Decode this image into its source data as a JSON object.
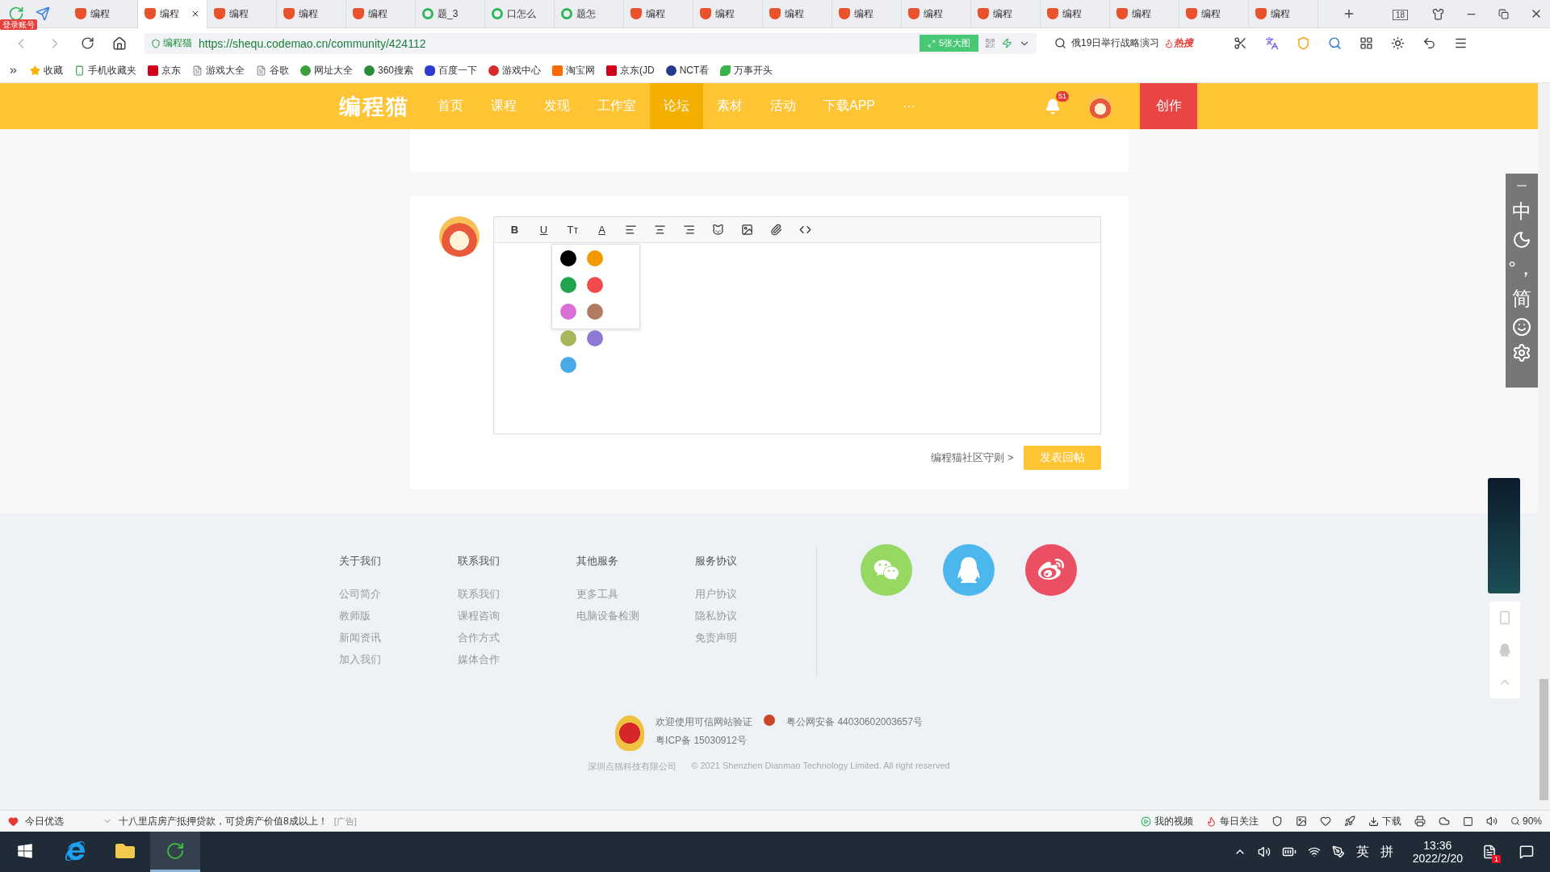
{
  "browser": {
    "login_badge": "登录账号",
    "tabs": [
      {
        "label": "编程",
        "kind": "site",
        "selected": false
      },
      {
        "label": "编程",
        "kind": "site",
        "selected": true
      },
      {
        "label": "编程",
        "kind": "site",
        "selected": false
      },
      {
        "label": "编程",
        "kind": "site",
        "selected": false
      },
      {
        "label": "编程",
        "kind": "site",
        "selected": false
      },
      {
        "label": "题_3",
        "kind": "search",
        "selected": false
      },
      {
        "label": "口怎么",
        "kind": "search",
        "selected": false
      },
      {
        "label": "题怎",
        "kind": "search",
        "selected": false
      },
      {
        "label": "编程",
        "kind": "site",
        "selected": false
      },
      {
        "label": "编程",
        "kind": "site",
        "selected": false
      },
      {
        "label": "编程",
        "kind": "site",
        "selected": false
      },
      {
        "label": "编程",
        "kind": "site",
        "selected": false
      },
      {
        "label": "编程",
        "kind": "site",
        "selected": false
      },
      {
        "label": "编程",
        "kind": "site",
        "selected": false
      },
      {
        "label": "编程",
        "kind": "site",
        "selected": false
      },
      {
        "label": "编程",
        "kind": "site",
        "selected": false
      },
      {
        "label": "编程",
        "kind": "site",
        "selected": false
      },
      {
        "label": "编程",
        "kind": "site",
        "selected": false
      }
    ],
    "tab_count": "18",
    "address": {
      "site_label": "编程猫",
      "url": "https://shequ.codemao.cn/community/424112",
      "image_button": "5张大图"
    },
    "search": {
      "value": "俄19日举行战略演习",
      "hot_label": "热搜"
    },
    "bookmarks": [
      {
        "label": "收藏",
        "kind": "star"
      },
      {
        "label": "手机收藏夹",
        "kind": "phone"
      },
      {
        "label": "京东",
        "kind": "jd"
      },
      {
        "label": "游戏大全",
        "kind": "page"
      },
      {
        "label": "谷歌",
        "kind": "page"
      },
      {
        "label": "网址大全",
        "kind": "compass"
      },
      {
        "label": "360搜索",
        "kind": "ring"
      },
      {
        "label": "百度一下",
        "kind": "paw"
      },
      {
        "label": "游戏中心",
        "kind": "game"
      },
      {
        "label": "淘宝网",
        "kind": "taobao"
      },
      {
        "label": "京东(JD",
        "kind": "jd"
      },
      {
        "label": "NCT看",
        "kind": "nct"
      },
      {
        "label": "万事开头",
        "kind": "leaf"
      }
    ]
  },
  "nav": {
    "logo": "编程猫",
    "items": [
      {
        "label": "首页",
        "selected": false
      },
      {
        "label": "课程",
        "selected": false
      },
      {
        "label": "发现",
        "selected": false
      },
      {
        "label": "工作室",
        "selected": false
      },
      {
        "label": "论坛",
        "selected": true
      },
      {
        "label": "素材",
        "selected": false
      },
      {
        "label": "活动",
        "selected": false
      },
      {
        "label": "下载APP",
        "selected": false
      }
    ],
    "more": "···",
    "notification_count": "51",
    "create_button": "创作"
  },
  "editor": {
    "toolbar": [
      {
        "kind": "bold",
        "label": "B"
      },
      {
        "kind": "underline",
        "label": "U"
      },
      {
        "kind": "font-size",
        "label": "Tт"
      },
      {
        "kind": "color",
        "label": "A"
      },
      {
        "kind": "align-left"
      },
      {
        "kind": "align-center"
      },
      {
        "kind": "align-right"
      },
      {
        "kind": "emoji"
      },
      {
        "kind": "image"
      },
      {
        "kind": "attachment"
      },
      {
        "kind": "code"
      }
    ],
    "colors": [
      {
        "color": "#000000"
      },
      {
        "color": "#f39800"
      },
      {
        "color": "#22a34f"
      },
      {
        "color": "#f34b4b"
      },
      {
        "color": "#d96fd6"
      },
      {
        "color": "#b07d63"
      },
      {
        "color": "#a6b65a"
      },
      {
        "color": "#8d78d4"
      },
      {
        "color": "#4ba8e6"
      }
    ],
    "guidelines_link": "编程猫社区守则 >",
    "submit_button": "发表回帖"
  },
  "footer": {
    "columns": [
      {
        "title": "关于我们",
        "links": [
          "公司简介",
          "教师版",
          "新闻资讯",
          "加入我们"
        ]
      },
      {
        "title": "联系我们",
        "links": [
          "联系我们",
          "课程咨询",
          "合作方式",
          "媒体合作"
        ]
      },
      {
        "title": "其他服务",
        "links": [
          "更多工具",
          "电脑设备检测"
        ]
      },
      {
        "title": "服务协议",
        "links": [
          "用户协议",
          "隐私协议",
          "免责声明"
        ]
      }
    ],
    "social": [
      {
        "kind": "wechat",
        "color": "#95d862"
      },
      {
        "kind": "qq",
        "color": "#4cb7ec"
      },
      {
        "kind": "weibo",
        "color": "#ea4f63"
      }
    ],
    "trust_text": "欢迎使用可信网站验证",
    "icp": "粤ICP备 15030912号",
    "police": "粤公网安备 44030602003657号",
    "company": "深圳点猫科技有限公司",
    "copyright": "© 2021 Shenzhen Dianmao Technology Limited. All right reserved"
  },
  "ime_panel": [
    {
      "kind": "text",
      "label": "中"
    },
    {
      "kind": "moon"
    },
    {
      "kind": "text",
      "label": "°，"
    },
    {
      "kind": "text",
      "label": "简"
    },
    {
      "kind": "smile"
    },
    {
      "kind": "gear"
    }
  ],
  "status_bar": {
    "daily_pick": "今日优选",
    "ad_text": "十八里店房产抵押贷款，可贷房产价值8成以上！",
    "ad_tag": "[广告]",
    "my_videos": "我的视频",
    "daily_follow": "每日关注",
    "download": "下载",
    "zoom": "90%"
  },
  "taskbar": {
    "apps": [
      {
        "kind": "ie",
        "selected": false
      },
      {
        "kind": "folder",
        "selected": false
      },
      {
        "kind": "browser360",
        "selected": true
      }
    ],
    "ime_lang": "英",
    "ime_mode": "拼",
    "time": "13:36",
    "date": "2022/2/20",
    "notification_count": "1"
  }
}
